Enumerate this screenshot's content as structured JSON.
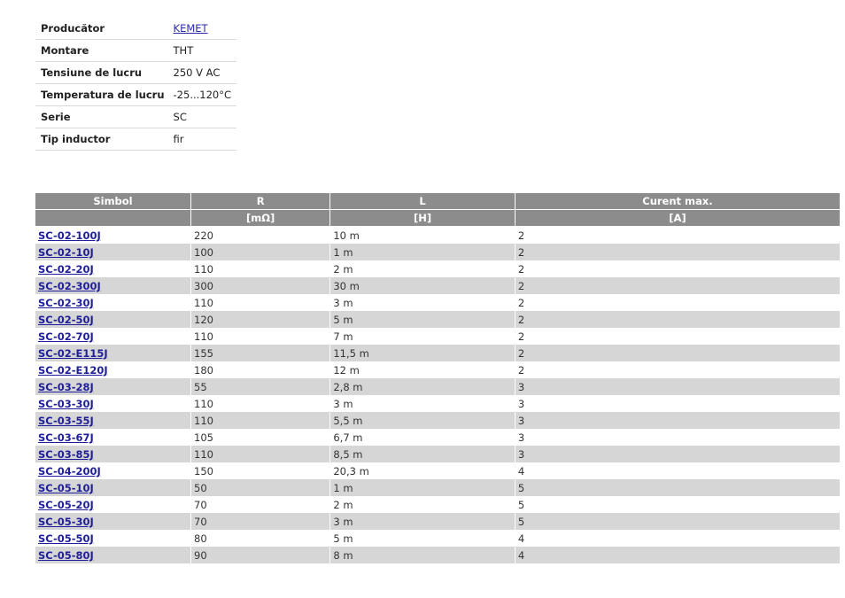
{
  "specs": [
    {
      "label": "Producător",
      "value": "KEMET",
      "link": true
    },
    {
      "label": "Montare",
      "value": "THT"
    },
    {
      "label": "Tensiune de lucru",
      "value": "250 V AC"
    },
    {
      "label": "Temperatura de lucru",
      "value": "-25...120°C"
    },
    {
      "label": "Serie",
      "value": "SC"
    },
    {
      "label": "Tip inductor",
      "value": "fir"
    }
  ],
  "table": {
    "headers": [
      "Simbol",
      "R",
      "L",
      "Curent max."
    ],
    "units": [
      "",
      "[mΩ]",
      "[H]",
      "[A]"
    ],
    "rows": [
      [
        "SC-02-100J",
        "220",
        "10 m",
        "2"
      ],
      [
        "SC-02-10J",
        "100",
        "1 m",
        "2"
      ],
      [
        "SC-02-20J",
        "110",
        "2 m",
        "2"
      ],
      [
        "SC-02-300J",
        "300",
        "30 m",
        "2"
      ],
      [
        "SC-02-30J",
        "110",
        "3 m",
        "2"
      ],
      [
        "SC-02-50J",
        "120",
        "5 m",
        "2"
      ],
      [
        "SC-02-70J",
        "110",
        "7 m",
        "2"
      ],
      [
        "SC-02-E115J",
        "155",
        "11,5 m",
        "2"
      ],
      [
        "SC-02-E120J",
        "180",
        "12 m",
        "2"
      ],
      [
        "SC-03-28J",
        "55",
        "2,8 m",
        "3"
      ],
      [
        "SC-03-30J",
        "110",
        "3 m",
        "3"
      ],
      [
        "SC-03-55J",
        "110",
        "5,5 m",
        "3"
      ],
      [
        "SC-03-67J",
        "105",
        "6,7 m",
        "3"
      ],
      [
        "SC-03-85J",
        "110",
        "8,5 m",
        "3"
      ],
      [
        "SC-04-200J",
        "150",
        "20,3 m",
        "4"
      ],
      [
        "SC-05-10J",
        "50",
        "1 m",
        "5"
      ],
      [
        "SC-05-20J",
        "70",
        "2 m",
        "5"
      ],
      [
        "SC-05-30J",
        "70",
        "3 m",
        "5"
      ],
      [
        "SC-05-50J",
        "80",
        "5 m",
        "4"
      ],
      [
        "SC-05-80J",
        "90",
        "8 m",
        "4"
      ]
    ]
  }
}
